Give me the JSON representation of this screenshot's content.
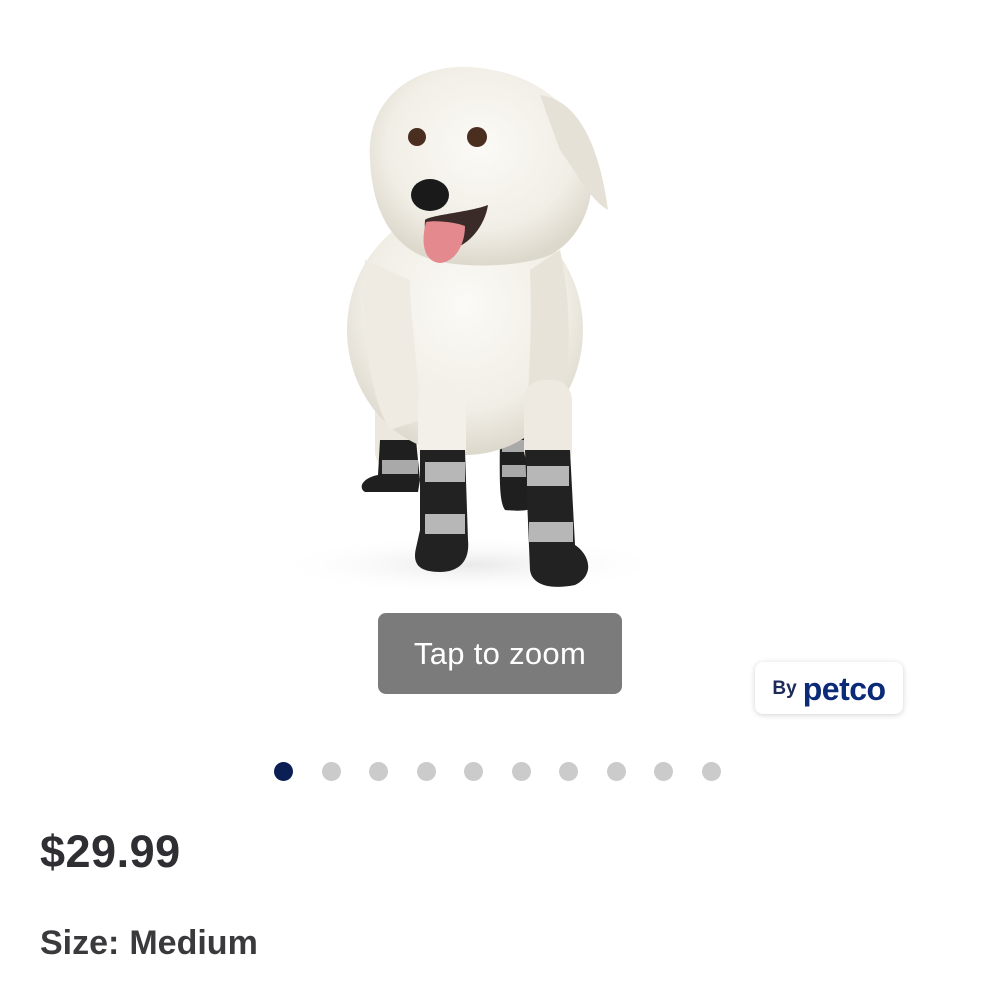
{
  "product": {
    "image_alt": "dog-in-boots-photo",
    "zoom_label": "Tap to zoom",
    "brand": {
      "prefix": "By",
      "name": "petco"
    },
    "carousel": {
      "total_images": 10,
      "active_index": 0
    },
    "price": "$29.99",
    "size": {
      "label": "Size:",
      "value": "Medium"
    }
  },
  "colors": {
    "active_dot": "#0c1f55",
    "inactive_dot": "#cbcbcb",
    "brand_blue": "#0b2a78",
    "zoom_button_bg": "#7b7b7b"
  }
}
